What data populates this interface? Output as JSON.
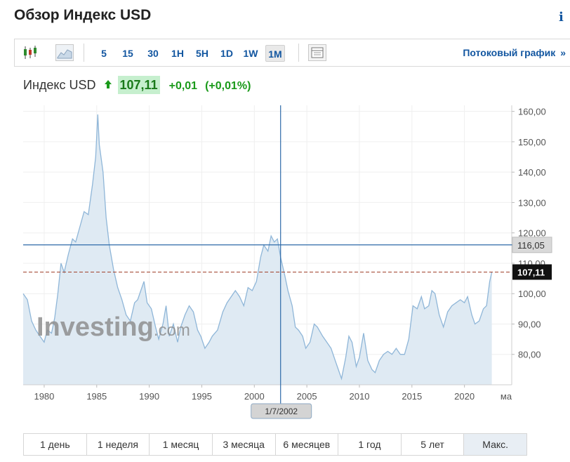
{
  "header": {
    "title": "Обзор Индекс USD",
    "info_icon": "i"
  },
  "toolbar": {
    "icons": [
      "candlestick-icon",
      "area-chart-icon",
      "table-view-icon"
    ],
    "intervals": [
      {
        "label": "5",
        "active": false
      },
      {
        "label": "15",
        "active": false
      },
      {
        "label": "30",
        "active": false
      },
      {
        "label": "1H",
        "active": false
      },
      {
        "label": "5H",
        "active": false
      },
      {
        "label": "1D",
        "active": false
      },
      {
        "label": "1W",
        "active": false
      },
      {
        "label": "1M",
        "active": true
      }
    ],
    "stream_label": "Потоковый график",
    "stream_arrow": "»"
  },
  "quote": {
    "name": "Индекс USD",
    "price": "107,11",
    "change": "+0,01",
    "change_pct": "(+0,01%)"
  },
  "watermark": {
    "brand": "Investing",
    "suffix": ".com"
  },
  "chart_data": {
    "type": "area",
    "x_ticks": [
      "1980",
      "1985",
      "1990",
      "1995",
      "2000",
      "2005",
      "2010",
      "2015",
      "2020",
      "ма"
    ],
    "y_ticks": [
      "80,00",
      "90,00",
      "100,00",
      "110,00",
      "120,00",
      "130,00",
      "140,00",
      "150,00",
      "160,00"
    ],
    "ylim": [
      70,
      162
    ],
    "xlim": [
      1978.0,
      2024.5
    ],
    "crosshair": {
      "date_label": "1/7/2002",
      "value_label": "116,05",
      "x": 2002.5,
      "y": 116.05
    },
    "last_price": {
      "label": "107,11",
      "y": 107.11
    },
    "series": [
      {
        "points": [
          [
            1978.0,
            100
          ],
          [
            1978.4,
            98
          ],
          [
            1978.8,
            91
          ],
          [
            1979.2,
            88
          ],
          [
            1979.6,
            86
          ],
          [
            1980.0,
            84
          ],
          [
            1980.3,
            88
          ],
          [
            1980.7,
            87
          ],
          [
            1981.0,
            92
          ],
          [
            1981.3,
            100
          ],
          [
            1981.6,
            110
          ],
          [
            1981.9,
            107
          ],
          [
            1982.3,
            113
          ],
          [
            1982.7,
            118
          ],
          [
            1983.0,
            117
          ],
          [
            1983.4,
            122
          ],
          [
            1983.8,
            127
          ],
          [
            1984.2,
            126
          ],
          [
            1984.6,
            136
          ],
          [
            1984.9,
            145
          ],
          [
            1985.1,
            159
          ],
          [
            1985.25,
            149
          ],
          [
            1985.6,
            140
          ],
          [
            1985.9,
            125
          ],
          [
            1986.2,
            116
          ],
          [
            1986.6,
            108
          ],
          [
            1987.0,
            102
          ],
          [
            1987.4,
            98
          ],
          [
            1987.8,
            93
          ],
          [
            1988.2,
            91
          ],
          [
            1988.6,
            97
          ],
          [
            1988.9,
            98
          ],
          [
            1989.2,
            101
          ],
          [
            1989.5,
            104
          ],
          [
            1989.8,
            97
          ],
          [
            1990.2,
            95
          ],
          [
            1990.6,
            89
          ],
          [
            1990.9,
            85
          ],
          [
            1991.3,
            90
          ],
          [
            1991.6,
            96
          ],
          [
            1991.9,
            86
          ],
          [
            1992.3,
            90
          ],
          [
            1992.7,
            84
          ],
          [
            1993.0,
            89
          ],
          [
            1993.4,
            93
          ],
          [
            1993.8,
            96
          ],
          [
            1994.2,
            94
          ],
          [
            1994.6,
            88
          ],
          [
            1994.9,
            86
          ],
          [
            1995.3,
            82
          ],
          [
            1995.7,
            84
          ],
          [
            1996.0,
            86
          ],
          [
            1996.5,
            88
          ],
          [
            1997.0,
            94
          ],
          [
            1997.4,
            97
          ],
          [
            1997.8,
            99
          ],
          [
            1998.2,
            101
          ],
          [
            1998.6,
            99
          ],
          [
            1999.0,
            96
          ],
          [
            1999.4,
            102
          ],
          [
            1999.8,
            101
          ],
          [
            2000.2,
            104
          ],
          [
            2000.6,
            112
          ],
          [
            2000.9,
            116
          ],
          [
            2001.3,
            114
          ],
          [
            2001.6,
            119
          ],
          [
            2001.9,
            117
          ],
          [
            2002.2,
            118
          ],
          [
            2002.5,
            112
          ],
          [
            2002.9,
            106
          ],
          [
            2003.2,
            101
          ],
          [
            2003.6,
            96
          ],
          [
            2003.9,
            89
          ],
          [
            2004.2,
            88
          ],
          [
            2004.6,
            86
          ],
          [
            2004.9,
            82
          ],
          [
            2005.3,
            84
          ],
          [
            2005.7,
            90
          ],
          [
            2006.0,
            89
          ],
          [
            2006.5,
            86
          ],
          [
            2006.9,
            84
          ],
          [
            2007.3,
            82
          ],
          [
            2007.7,
            78
          ],
          [
            2008.0,
            75
          ],
          [
            2008.3,
            72
          ],
          [
            2008.7,
            79
          ],
          [
            2009.0,
            86
          ],
          [
            2009.3,
            84
          ],
          [
            2009.7,
            76
          ],
          [
            2010.0,
            79
          ],
          [
            2010.4,
            87
          ],
          [
            2010.8,
            78
          ],
          [
            2011.2,
            75
          ],
          [
            2011.5,
            74
          ],
          [
            2011.9,
            78
          ],
          [
            2012.3,
            80
          ],
          [
            2012.7,
            81
          ],
          [
            2013.1,
            80
          ],
          [
            2013.5,
            82
          ],
          [
            2013.9,
            80
          ],
          [
            2014.3,
            80
          ],
          [
            2014.7,
            85
          ],
          [
            2015.1,
            96
          ],
          [
            2015.5,
            95
          ],
          [
            2015.9,
            99
          ],
          [
            2016.2,
            95
          ],
          [
            2016.6,
            96
          ],
          [
            2016.9,
            101
          ],
          [
            2017.2,
            100
          ],
          [
            2017.6,
            93
          ],
          [
            2018.0,
            89
          ],
          [
            2018.4,
            94
          ],
          [
            2018.8,
            96
          ],
          [
            2019.2,
            97
          ],
          [
            2019.6,
            98
          ],
          [
            2020.0,
            97
          ],
          [
            2020.3,
            99
          ],
          [
            2020.7,
            93
          ],
          [
            2021.0,
            90
          ],
          [
            2021.4,
            91
          ],
          [
            2021.8,
            95
          ],
          [
            2022.1,
            96
          ],
          [
            2022.4,
            104
          ],
          [
            2022.6,
            107.11
          ]
        ]
      }
    ]
  },
  "range_buttons": [
    {
      "label": "1 день",
      "active": false
    },
    {
      "label": "1 неделя",
      "active": false
    },
    {
      "label": "1 месяц",
      "active": false
    },
    {
      "label": "3 месяца",
      "active": false
    },
    {
      "label": "6 месяцев",
      "active": false
    },
    {
      "label": "1 год",
      "active": false
    },
    {
      "label": "5 лет",
      "active": false
    },
    {
      "label": "Макс.",
      "active": true
    }
  ],
  "colors": {
    "accent": "#1256a0",
    "up": "#1a9a1a",
    "area_fill": "#dfeaf3",
    "area_line": "#8fb6d8",
    "crosshair": "#2d6aa8",
    "last_price_line": "#a0402a"
  }
}
